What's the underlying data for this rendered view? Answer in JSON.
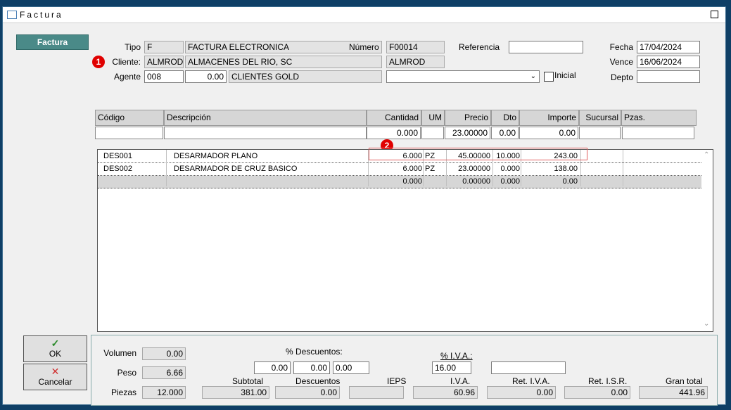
{
  "window": {
    "title": "Factura"
  },
  "sidebar": {
    "factura_tab": "Factura",
    "ok_label": "OK",
    "cancel_label": "Cancelar"
  },
  "badges": {
    "one": "1",
    "two": "2"
  },
  "header": {
    "tipo_label": "Tipo",
    "tipo_code": "F",
    "tipo_desc": "FACTURA ELECTRONICA",
    "numero_label": "Número",
    "numero_value": "F00014",
    "referencia_label": "Referencia",
    "referencia_value": "",
    "fecha_label": "Fecha",
    "fecha_value": "17/04/2024",
    "cliente_label": "Cliente:",
    "cliente_code": "ALMROD",
    "cliente_name": "ALMACENES DEL RIO, SC",
    "cliente_alias": "ALMROD",
    "vence_label": "Vence",
    "vence_value": "16/06/2024",
    "agente_label": "Agente",
    "agente_code": "008",
    "agente_value": "0.00",
    "agente_name": "CLIENTES GOLD",
    "inicial_label": "Inicial",
    "depto_label": "Depto",
    "depto_value": ""
  },
  "columns": [
    "Código",
    "Descripción",
    "Cantidad",
    "UM",
    "Precio",
    "Dto",
    "Importe",
    "Sucursal",
    "Pzas."
  ],
  "entry": {
    "cantidad": "0.000",
    "precio": "23.00000",
    "dto": "0.00",
    "importe": "0.00"
  },
  "rows": [
    {
      "codigo": "DES001",
      "descripcion": "DESARMADOR PLANO",
      "cantidad": "6.000",
      "um": "PZ",
      "precio": "45.00000",
      "dto": "10.000",
      "importe": "243.00"
    },
    {
      "codigo": "DES002",
      "descripcion": "DESARMADOR DE CRUZ BASICO",
      "cantidad": "6.000",
      "um": "PZ",
      "precio": "23.00000",
      "dto": "0.000",
      "importe": "138.00"
    },
    {
      "codigo": "",
      "descripcion": "",
      "cantidad": "0.000",
      "um": "",
      "precio": "0.00000",
      "dto": "0.000",
      "importe": "0.00"
    }
  ],
  "totals": {
    "volumen_label": "Volumen",
    "volumen_value": "0.00",
    "peso_label": "Peso",
    "peso_value": "6.66",
    "piezas_label": "Piezas",
    "piezas_value": "12.000",
    "descuentos_pct_label": "% Descuentos:",
    "desc1": "0.00",
    "desc2": "0.00",
    "desc3": "0.00",
    "iva_pct_label": "% I.V.A.:",
    "iva_pct_value": "16.00",
    "extra_value": "",
    "subtotal_label": "Subtotal",
    "subtotal_value": "381.00",
    "descuentos_label": "Descuentos",
    "descuentos_value": "0.00",
    "ieps_label": "IEPS",
    "ieps_value": "",
    "iva_label": "I.V.A.",
    "iva_value": "60.96",
    "ret_iva_label": "Ret. I.V.A.",
    "ret_iva_value": "0.00",
    "ret_isr_label": "Ret. I.S.R.",
    "ret_isr_value": "0.00",
    "gran_total_label": "Gran total",
    "gran_total_value": "441.96"
  },
  "colors": {
    "accent": "#4a8a88",
    "badge": "#e00000",
    "ok_check": "#2a8a2a",
    "cancel_x": "#d03030"
  }
}
